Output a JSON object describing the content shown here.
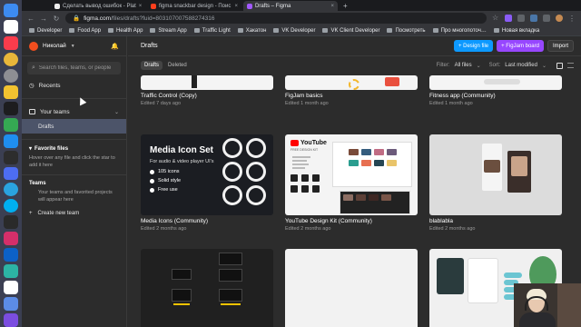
{
  "browser": {
    "tabs": [
      {
        "label": "Сделать вывод ошибок - Plat",
        "active": false
      },
      {
        "label": "figma snackbar design - Поис",
        "active": false
      },
      {
        "label": "Drafts – Figma",
        "active": true
      }
    ],
    "address": {
      "host": "figma.com",
      "path": "/files/drafts?fuid=803107007588274316"
    },
    "bookmarks": [
      "Developer",
      "Food App",
      "Health App",
      "Stream App",
      "Traffic Light",
      "Хакатон",
      "VK Developer",
      "VK Client Developer",
      "Посмотреть",
      "Про многопоточ…",
      "Новая вкладка"
    ]
  },
  "sidebar": {
    "user_name": "Николай",
    "search_placeholder": "Search files, teams, or people",
    "recents": "Recents",
    "your_teams": "Your teams",
    "drafts": "Drafts",
    "favorite_title": "Favorite files",
    "favorite_desc": "Hover over any file and click the star to add it here",
    "teams_title": "Teams",
    "teams_desc": "Your teams and favorited projects will appear here",
    "create_team": "Create new team"
  },
  "main": {
    "title": "Drafts",
    "buttons": {
      "design": "+ Design file",
      "figjam": "+ FigJam board",
      "import": "Import"
    },
    "filters": {
      "drafts_tab": "Drafts",
      "deleted_tab": "Deleted",
      "filter_label": "Filter:",
      "filter_value": "All files",
      "sort_label": "Sort:",
      "sort_value": "Last modified"
    }
  },
  "files": [
    {
      "name": "Traffic Control (Copy)",
      "meta": "Edited 7 days ago"
    },
    {
      "name": "FigJam basics",
      "meta": "Edited 1 month ago"
    },
    {
      "name": "Fitness app (Community)",
      "meta": "Edited 1 month ago"
    },
    {
      "name": "Media Icons (Community)",
      "meta": "Edited 2 months ago"
    },
    {
      "name": "YouTube Design Kit (Community)",
      "meta": "Edited 2 months ago"
    },
    {
      "name": "blablabla",
      "meta": "Edited 2 months ago"
    }
  ],
  "media_thumb": {
    "title": "Media Icon Set",
    "subtitle": "For audio & video player UI's",
    "features": [
      "105 icons",
      "Solid style",
      "Free use"
    ]
  },
  "youtube_thumb": {
    "logo": "YouTube",
    "sub": "FREE DESIGN KIT"
  },
  "colors": {
    "figma_blue": "#0d99ff",
    "figma_violet": "#9747ff",
    "sidebar_selected": "#4c5469",
    "bg": "#2c2c2c"
  }
}
